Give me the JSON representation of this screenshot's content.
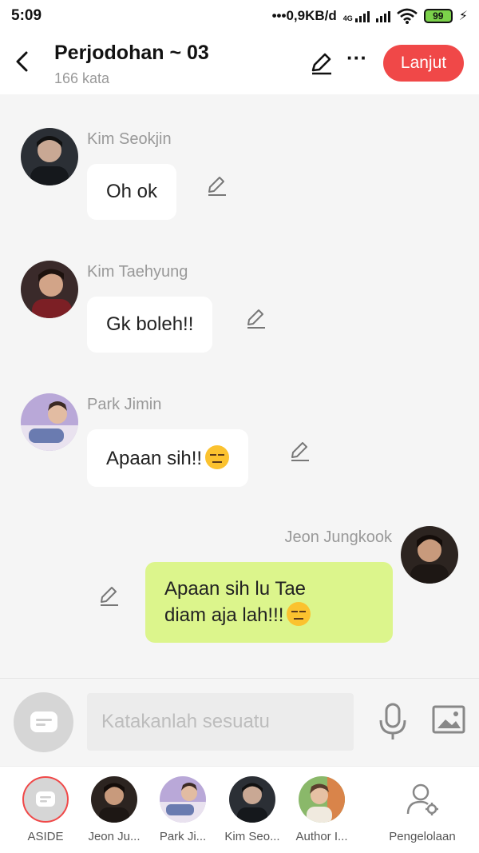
{
  "status_bar": {
    "time": "5:09",
    "network_speed": "0,9KB/d",
    "network_type": "4G",
    "battery": "99"
  },
  "header": {
    "title": "Perjodohan ~ 03",
    "word_count": "166 kata",
    "next_label": "Lanjut",
    "accent_color": "#f04848"
  },
  "messages": [
    {
      "sender": "Kim Seokjin",
      "text": "Oh ok",
      "side": "left",
      "avatar_icon": "seokjin-avatar"
    },
    {
      "sender": "Kim Taehyung",
      "text": "Gk boleh!!",
      "side": "left",
      "avatar_icon": "taehyung-avatar"
    },
    {
      "sender": "Park Jimin",
      "text": "Apaan sih!!",
      "emoji": "expressionless-face",
      "side": "left",
      "avatar_icon": "jimin-avatar"
    },
    {
      "sender": "Jeon Jungkook",
      "text_line1": "Apaan sih lu Tae",
      "text_line2": "diam aja lah!!!",
      "emoji": "expressionless-face",
      "side": "right",
      "avatar_icon": "jungkook-avatar"
    }
  ],
  "composer": {
    "placeholder": "Katakanlah sesuatu"
  },
  "characters": [
    {
      "label": "ASIDE"
    },
    {
      "label": "Jeon Ju..."
    },
    {
      "label": "Park Ji..."
    },
    {
      "label": "Kim Seo..."
    },
    {
      "label": "Author I..."
    },
    {
      "label": "Pengelolaan"
    }
  ],
  "colors": {
    "own_bubble": "#dcf58c",
    "other_bubble": "#ffffff",
    "background": "#f5f5f5"
  }
}
